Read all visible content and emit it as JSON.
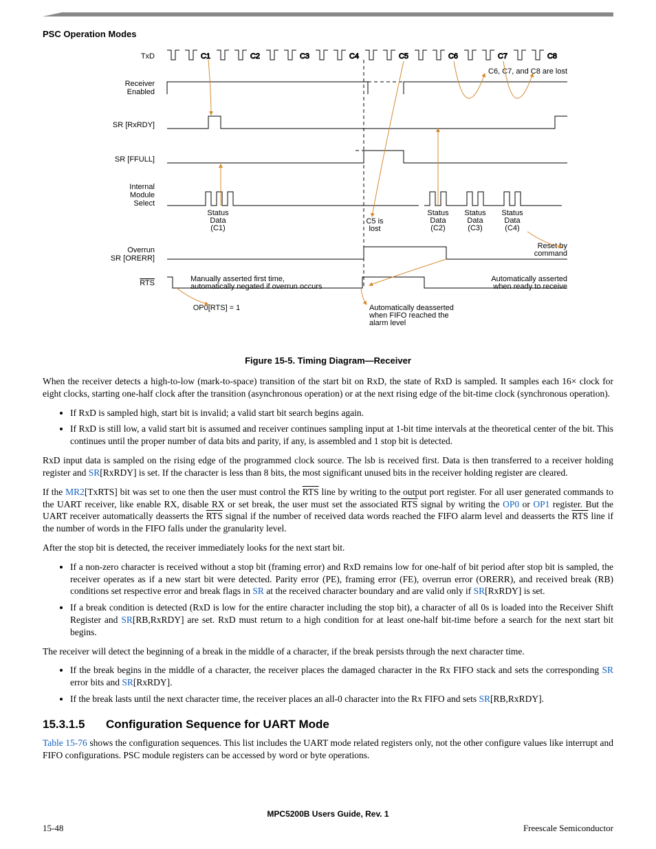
{
  "header": {
    "section": "PSC Operation Modes"
  },
  "figure": {
    "caption": "Figure 15-5. Timing Diagram—Receiver",
    "signals": [
      "TxD",
      "Receiver Enabled",
      "SR [RxRDY]",
      "SR [FFULL]",
      "Internal Module Select",
      "Overrun SR [ORERR]",
      "RTS"
    ],
    "txd_chars": [
      "C1",
      "C2",
      "C3",
      "C4",
      "C5",
      "C6",
      "C7",
      "C8"
    ],
    "lost_note": "C6, C7, and C8 are lost",
    "status_c1": "Status Data (C1)",
    "status_c2": "Status Data (C2)",
    "status_c3": "Status Data (C3)",
    "status_c4": "Status Data (C4)",
    "c5_lost": "C5 is lost",
    "reset_cmd": "Reset by command",
    "manual_assert": "Manually asserted first time, automatically negated if overrun occurs",
    "auto_assert": "Automatically asserted when ready to receive",
    "op0_rts": "OP0[RTS] = 1",
    "auto_deassert": "Automatically deasserted when FIFO reached the alarm level"
  },
  "para1": "When the receiver detects a high-to-low (mark-to-space) transition of the start bit on RxD, the state of RxD is sampled. It samples each 16× clock for eight clocks, starting one-half clock after the transition (asynchronous operation) or at the next rising edge of the bit-time clock (synchronous operation).",
  "bulletsA": [
    "If RxD is sampled high, start bit is invalid; a valid start bit search begins again.",
    "If RxD is still low, a valid start bit is assumed and receiver continues sampling input at 1-bit time intervals at the theoretical center of the bit. This continues until the proper number of data bits and parity, if any, is assembled and 1 stop bit is detected."
  ],
  "para2_pre": "RxD input data is sampled on the rising edge of the programmed clock source. The lsb is received first. Data is then transferred to a receiver holding register and ",
  "para2_sr": "SR",
  "para2_post": "[RxRDY] is set. If the character is less than 8 bits, the most significant unused bits in the receiver holding register are cleared.",
  "para3": {
    "a": "If the ",
    "mr2": "MR2",
    "b": "[TxRTS] bit was set to one then the user must control the ",
    "rts1": "RTS",
    "c": " line by writing to the output port register. For all user generated commands to the UART receiver, like enable RX, disable RX or set break, the user must set the associated ",
    "rts2": "RTS",
    "d": " signal by writing the ",
    "op0": "OP0",
    "e": " or ",
    "op1": "OP1",
    "f": " register. But the UART receiver automatically deasserts the ",
    "rts3": "RTS",
    "g": " signal if the number of received data words reached the FIFO alarm level and deasserts the ",
    "rts4": "RTS",
    "h": " line if the number of words in the FIFO falls under the granularity level."
  },
  "para4": "After the stop bit is detected, the receiver immediately looks for the next start bit.",
  "bulletsB": [
    {
      "pre": "If a non-zero character is received without a stop bit (framing error) and RxD remains low for one-half of bit period after stop bit is sampled, the receiver operates as if a new start bit were detected. Parity error (PE), framing error (FE), overrun error (ORERR), and received break (RB) conditions set respective error and break flags in ",
      "sr1": "SR",
      "mid": " at the received character boundary and are valid only if ",
      "sr2": "SR",
      "post": "[RxRDY] is set."
    },
    {
      "pre": "If a break condition is detected (RxD is low for the entire character including the stop bit), a character of all 0s is loaded into the Receiver Shift Register and ",
      "sr1": "SR",
      "post": "[RB,RxRDY] are set. RxD must return to a high condition for at least one-half bit-time before a search for the next start bit begins."
    }
  ],
  "para5": "The receiver will detect the beginning of a break in the middle of a character, if the break persists through the next character time.",
  "bulletsC": [
    {
      "pre": "If the break begins in the middle of a character, the receiver places the damaged character in the Rx FIFO stack and sets the corresponding ",
      "sr1": "SR",
      "mid": " error bits and ",
      "sr2": "SR",
      "post": "[RxRDY]."
    },
    {
      "pre": "If the break lasts until the next character time, the receiver places an all-0 character into the Rx FIFO and sets ",
      "sr1": "SR",
      "post": "[RB,RxRDY]."
    }
  ],
  "subsection": {
    "num": "15.3.1.5",
    "title": "Configuration Sequence for UART Mode"
  },
  "para6_pre": "",
  "para6_xref": "Table 15-76",
  "para6_post": " shows the configuration sequences. This list includes the UART mode related registers only, not the other configure values like interrupt and FIFO configurations. PSC module registers can be accessed by word or byte operations.",
  "footer": {
    "center": "MPC5200B Users Guide, Rev. 1",
    "left": "15-48",
    "right": "Freescale Semiconductor"
  }
}
